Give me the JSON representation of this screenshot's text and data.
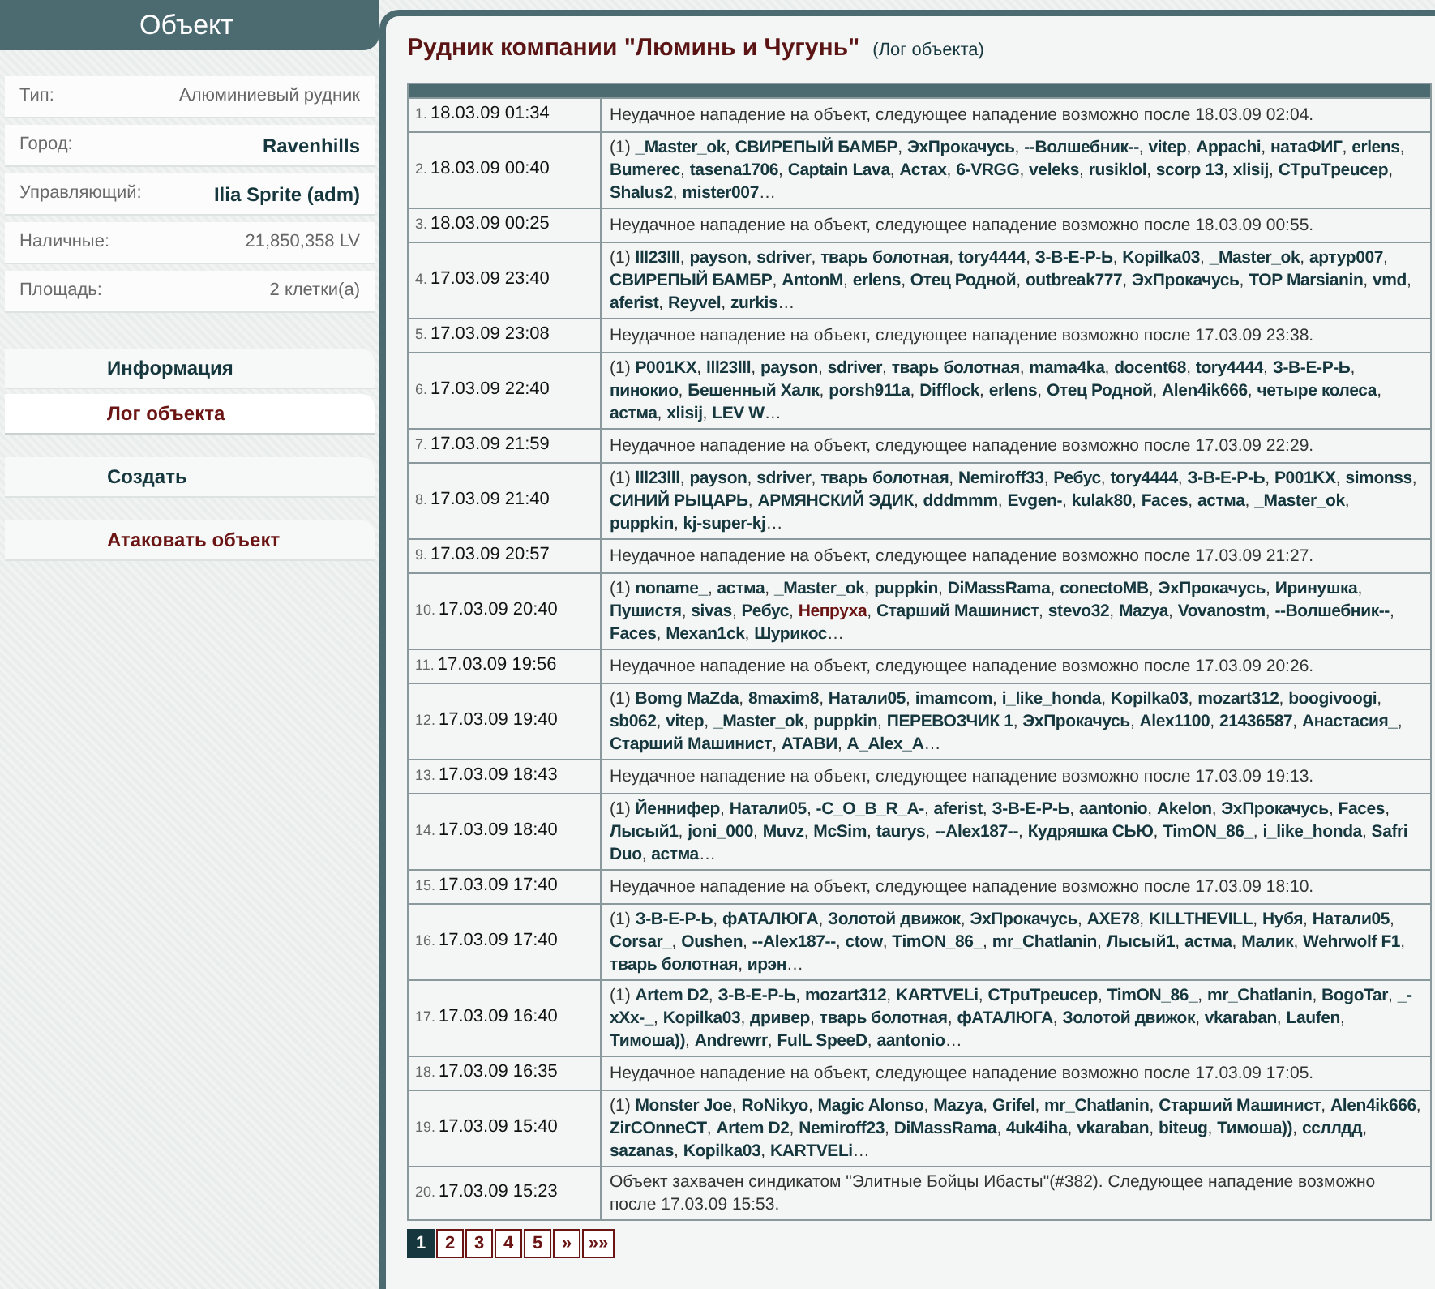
{
  "sidebar": {
    "title": "Объект",
    "info": [
      {
        "label": "Тип:",
        "value": "Алюминиевый рудник",
        "emphasis": false
      },
      {
        "label": "Город:",
        "value": "Ravenhills",
        "emphasis": true
      },
      {
        "label": "Управляющий:",
        "value": "Ilia Sprite (adm)",
        "emphasis": true
      },
      {
        "label": "Наличные:",
        "value": "21,850,358 LV",
        "emphasis": false
      },
      {
        "label": "Площадь:",
        "value": "2 клетки(а)",
        "emphasis": false
      }
    ],
    "menu_groups": [
      [
        {
          "label": "Информация",
          "selected": false,
          "kind": "nav"
        },
        {
          "label": "Лог объекта",
          "selected": true,
          "kind": "nav"
        }
      ],
      [
        {
          "label": "Создать",
          "selected": false,
          "kind": "nav"
        }
      ],
      [
        {
          "label": "Атаковать объект",
          "selected": false,
          "kind": "action"
        }
      ]
    ]
  },
  "main": {
    "title": "Рудник компании \"Люминь и Чугунь\"",
    "subtitle": "(Лог объекта)"
  },
  "log": [
    {
      "index": "1.",
      "time": "18.03.09 01:34",
      "kind": "message",
      "text": "Неудачное нападение на объект, следующее нападение возможно после 18.03.09 02:04."
    },
    {
      "index": "2.",
      "time": "18.03.09 00:40",
      "kind": "attack",
      "parts": [
        {
          "text": "(1) **_Master_ok**, **СВИРЕПЫЙ БАМБР**, **ЭхПрокачусь**, **--Волшебник--**, **vitep**, **Appachi**, **натаФИГ**, **erlens**, **Bumerec**, **tasena1706**, **Captain Lava**, **Астах**, **6-VRGG**, **veleks**, **rusiklol**, **scorp 13**, **xlisij**, **CTpuTpeucep**, **Shalus2**, **mister007**…"
        }
      ]
    },
    {
      "index": "3.",
      "time": "18.03.09 00:25",
      "kind": "message",
      "text": "Неудачное нападение на объект, следующее нападение возможно после 18.03.09 00:55."
    },
    {
      "index": "4.",
      "time": "17.03.09 23:40",
      "kind": "attack",
      "parts": [
        {
          "text": "(1) **lll23lll**, **payson**, **sdriver**, **тварь болотная**, **tory4444**, **З-В-Е-Р-Ь**, **Kopilka03**, **_Master_ok**, **артур007**, **СВИРЕПЫЙ БАМБР**, **AntonM**, **erlens**, **Отец Родной**, **outbreak777**, **ЭхПрокачусь**, **TOP Marsianin**, **vmd**, **aferist**, **Reyvel**, **zurkis**…"
        }
      ]
    },
    {
      "index": "5.",
      "time": "17.03.09 23:08",
      "kind": "message",
      "text": "Неудачное нападение на объект, следующее нападение возможно после 17.03.09 23:38."
    },
    {
      "index": "6.",
      "time": "17.03.09 22:40",
      "kind": "attack",
      "parts": [
        {
          "text": "(1) **P001KX**, **lll23lll**, **payson**, **sdriver**, **тварь болотная**, **mama4ka**, **docent68**, **tory4444**, **З-В-Е-Р-Ь**, **пинокио**, **Бешенный Халк**, **porsh911a**, **Difflock**, **erlens**, **Отец Родной**, **Alen4ik666**, **четыре колеса**, **астма**, **xlisij**, **LEV W**…"
        }
      ]
    },
    {
      "index": "7.",
      "time": "17.03.09 21:59",
      "kind": "message",
      "text": "Неудачное нападение на объект, следующее нападение возможно после 17.03.09 22:29."
    },
    {
      "index": "8.",
      "time": "17.03.09 21:40",
      "kind": "attack",
      "parts": [
        {
          "text": "(1) **lll23lll**, **payson**, **sdriver**, **тварь болотная**, **Nemiroff33**, **Ребус**, **tory4444**, **З-В-Е-Р-Ь**, **P001KX**, **simonss**, **СИНИЙ РЫЦАРЬ**, **АРМЯНСКИЙ ЭДИК**, **dddmmm**, **Evgen-**, **kulak80**, **Faces**, **астма**, **_Master_ok**, **puppkin**, **kj-super-kj**…"
        }
      ]
    },
    {
      "index": "9.",
      "time": "17.03.09 20:57",
      "kind": "message",
      "text": "Неудачное нападение на объект, следующее нападение возможно после 17.03.09 21:27."
    },
    {
      "index": "10.",
      "time": "17.03.09 20:40",
      "kind": "attack",
      "parts": [
        {
          "text": "(1) **noname_**, **астма**, **_Master_ok**, **puppkin**, **DiMassRama**, **conectoMB**, **ЭхПрокачусь**, **Иринушка**, **Пушистя**, **sivas**, **Ребус**, "
        },
        {
          "text": "**Непруха**",
          "color": "#6b1414"
        },
        {
          "text": ", **Старший Машинист**, **stevo32**, **Mazya**, **Vovanostm**, **--Волшебник--**, **Faces**, **Mexan1ck**, **Шурикос**…"
        }
      ]
    },
    {
      "index": "11.",
      "time": "17.03.09 19:56",
      "kind": "message",
      "text": "Неудачное нападение на объект, следующее нападение возможно после 17.03.09 20:26."
    },
    {
      "index": "12.",
      "time": "17.03.09 19:40",
      "kind": "attack",
      "parts": [
        {
          "text": "(1) **Bomg MaZda**, **8maxim8**, **Натали05**, **imamcom**, **i_like_honda**, **Kopilka03**, **mozart312**, **boogivoogi**, **sb062**, **vitep**, **_Master_ok**, **puppkin**, **ПЕРЕВОЗЧИК 1**, **ЭхПрокачусь**, **Alex1100**, **21436587**, **Анастасия_**, **Старший Машинист**, **АТАВИ**, **A_Alex_A**…"
        }
      ]
    },
    {
      "index": "13.",
      "time": "17.03.09 18:43",
      "kind": "message",
      "text": "Неудачное нападение на объект, следующее нападение возможно после 17.03.09 19:13."
    },
    {
      "index": "14.",
      "time": "17.03.09 18:40",
      "kind": "attack",
      "parts": [
        {
          "text": "(1) **Йеннифер**, **Натали05**, **-C_O_B_R_A-**, **aferist**, **З-В-Е-Р-Ь**, **aantonio**, **Akelon**, **ЭхПрокачусь**, **Faces**, **Лысый1**, **joni_000**, **Muvz**, **McSim**, **taurys**, **--Alex187--**, **Кудряшка СЬЮ**, **TimON_86_**, **i_like_honda**, **Safri Duo**, **астма**…"
        }
      ]
    },
    {
      "index": "15.",
      "time": "17.03.09 17:40",
      "kind": "message",
      "text": "Неудачное нападение на объект, следующее нападение возможно после 17.03.09 18:10."
    },
    {
      "index": "16.",
      "time": "17.03.09 17:40",
      "kind": "attack",
      "parts": [
        {
          "text": "(1) **З-В-Е-Р-Ь**, **фАТАЛЮГА**, **Золотой движок**, **ЭхПрокачусь**, **AXE78**, **KILLTHEVILL**, **Нубя**, **Натали05**, **Corsar_**, **Oushen**, **--Alex187--**, **ctow**, **TimON_86_**, **mr_Chatlanin**, **Лысый1**, **астма**, **Малик**, **Wehrwolf F1**, **тварь болотная**, **ирэн**…"
        }
      ]
    },
    {
      "index": "17.",
      "time": "17.03.09 16:40",
      "kind": "attack",
      "parts": [
        {
          "text": "(1) **Artem D2**, **З-В-Е-Р-Ь**, **mozart312**, **KARTVELi**, **CTpuTpeucep**, **TimON_86_**, **mr_Chatlanin**, **BogoTar**, **_-xXx-_**, **Kopilka03**, **дривер**, **тварь болотная**, **фАТАЛЮГА**, **Золотой движок**, **vkaraban**, **Laufen**, **Тимоша))**, **Andrewrr**, **FulL SpeeD**, **aantonio**…"
        }
      ]
    },
    {
      "index": "18.",
      "time": "17.03.09 16:35",
      "kind": "message",
      "text": "Неудачное нападение на объект, следующее нападение возможно после 17.03.09 17:05."
    },
    {
      "index": "19.",
      "time": "17.03.09 15:40",
      "kind": "attack",
      "parts": [
        {
          "text": "(1) **Monster Joe**, **RoNikyo**, **Magic Alonso**, **Mazya**, **Grifel**, **mr_Chatlanin**, **Старший Машинист**, **Alen4ik666**, **ZirCOnneCT**, **Artem D2**, **Nemiroff23**, **DiMassRama**, **4uk4iha**, **vkaraban**, **biteug**, **Тимоша))**, **ссллдд**, **sazanas**, **Kopilka03**, **KARTVELi**…"
        }
      ]
    },
    {
      "index": "20.",
      "time": "17.03.09 15:23",
      "kind": "message",
      "text": "Объект захвачен синдикатом \"Элитные Бойцы Ибасты\"(#382). Следующее нападение возможно после 17.03.09 15:53."
    }
  ],
  "pagination": [
    {
      "label": "1",
      "selected": true
    },
    {
      "label": "2",
      "selected": false
    },
    {
      "label": "3",
      "selected": false
    },
    {
      "label": "4",
      "selected": false
    },
    {
      "label": "5",
      "selected": false
    },
    {
      "label": "»",
      "selected": false
    },
    {
      "label": "»»",
      "selected": false
    }
  ]
}
